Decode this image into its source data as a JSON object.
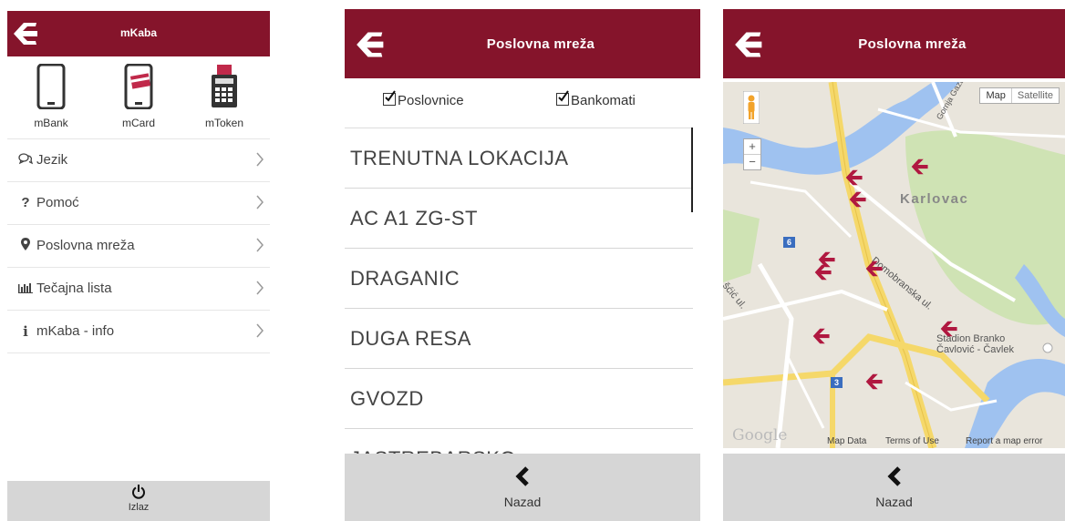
{
  "colors": {
    "brand": "#85142b",
    "bottom_bar": "#d6d6d6"
  },
  "screen1": {
    "title": "mKaba",
    "apps": [
      {
        "label": "mBank",
        "icon": "phone-icon"
      },
      {
        "label": "mCard",
        "icon": "phone-card-icon"
      },
      {
        "label": "mToken",
        "icon": "token-icon"
      }
    ],
    "menu": [
      {
        "label": "Jezik",
        "icon": "language-icon"
      },
      {
        "label": "Pomoć",
        "icon": "help-icon"
      },
      {
        "label": "Poslovna mreža",
        "icon": "location-pin-icon"
      },
      {
        "label": "Tečajna lista",
        "icon": "bar-chart-icon"
      },
      {
        "label": "mKaba - info",
        "icon": "info-icon"
      }
    ],
    "exit_label": "Izlaz"
  },
  "screen2": {
    "title": "Poslovna mreža",
    "filters": [
      {
        "label": "Poslovnice",
        "checked": true
      },
      {
        "label": "Bankomati",
        "checked": true
      }
    ],
    "locations": [
      "TRENUTNA LOKACIJA",
      "AC A1 ZG-ST",
      "DRAGANIC",
      "DUGA RESA",
      "GVOZD",
      "JASTREBARSKO"
    ],
    "back_label": "Nazad"
  },
  "screen3": {
    "title": "Poslovna mreža",
    "map": {
      "type_buttons": [
        "Map",
        "Satellite"
      ],
      "zoom_in": "+",
      "zoom_out": "−",
      "city_label": "Karlovac",
      "street_1": "Domobranska ul.",
      "street_2": "Gornja Gaza",
      "street_3": "šćić ul.",
      "stadium": "Stadion Branko Čavlović - Čavlek",
      "road_6": "6",
      "road_3": "3",
      "google": "Google",
      "footer": [
        "Map Data",
        "Terms of Use",
        "Report a map error"
      ]
    },
    "back_label": "Nazad"
  }
}
